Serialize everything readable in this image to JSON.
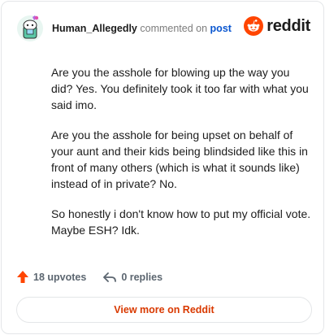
{
  "header": {
    "author": "Human_Allegedly",
    "verb": "commented on",
    "link_text": "post",
    "brand": "reddit"
  },
  "comment": {
    "paragraphs": [
      "Are you the asshole for blowing up the way you did? Yes. You definitely took it too far with what you said imo.",
      "Are you the asshole for being upset on behalf of your aunt and their kids being blindsided like this in front of many others (which is what it sounds like) instead of in private? No.",
      "So honestly i don't know how to put my official vote. Maybe ESH? Idk."
    ]
  },
  "actions": {
    "upvotes": "18 upvotes",
    "replies": "0 replies"
  },
  "footer": {
    "view_more": "View more on Reddit"
  },
  "colors": {
    "brand_orange": "#ff4500",
    "upvote_orange": "#ff4500",
    "link_blue": "#0b57d0",
    "cta_text": "#d93900",
    "muted_text": "#5c6670"
  },
  "icons": {
    "avatar": "snoo-avatar-icon",
    "brand": "reddit-logo-icon",
    "upvote": "upvote-arrow-icon",
    "reply": "reply-arrow-icon"
  }
}
